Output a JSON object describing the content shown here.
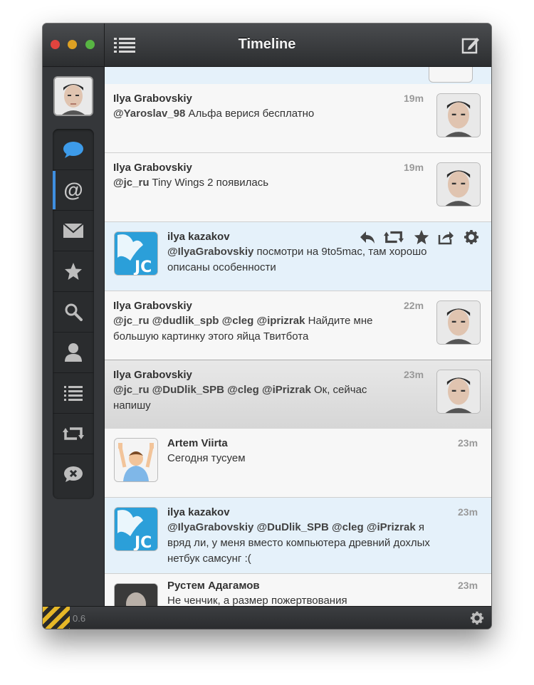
{
  "window": {
    "title": "Timeline"
  },
  "bottom": {
    "version": "0.6"
  },
  "sidebar": {
    "items": [
      {
        "name": "timeline-icon"
      },
      {
        "name": "mentions-icon"
      },
      {
        "name": "messages-icon"
      },
      {
        "name": "favorites-icon"
      },
      {
        "name": "search-icon"
      },
      {
        "name": "profile-icon"
      },
      {
        "name": "lists-icon"
      },
      {
        "name": "retweets-icon"
      },
      {
        "name": "muted-icon"
      }
    ]
  },
  "tweets": [
    {
      "name": "Ilya Grabovskiy",
      "time": "19m",
      "m1": "@Yaroslav_98",
      "t1": " Альфа верися бесплатно"
    },
    {
      "name": "Ilya Grabovskiy",
      "time": "19m",
      "m1": "@jc_ru",
      "t1": " Tiny Wings 2 появилась"
    },
    {
      "name": "ilya kazakov",
      "m1": "@IlyaGrabovskiy",
      "t1": " посмотри на 9to5mac, там хорошо",
      "line2": "описаны особенности",
      "avatar_text": "JC"
    },
    {
      "name": "Ilya Grabovskiy",
      "time": "22m",
      "m1": "@jc_ru",
      "m2": "@dudlik_spb",
      "m3": "@cleg",
      "m4": "@iprizrak",
      "t1": " Найдите мне",
      "line2": "большую картинку этого яйца Твитбота"
    },
    {
      "name": "Ilya Grabovskiy",
      "time": "23m",
      "m1": "@jc_ru",
      "m2": "@DuDlik_SPB",
      "m3": "@cleg",
      "m4": "@iPrizrak",
      "t1": " Ок, сейчас",
      "line2": "напишу"
    },
    {
      "name": "Artem Viirta",
      "time": "23m",
      "t1": "Сегодня тусуем"
    },
    {
      "name": "ilya kazakov",
      "time": "23m",
      "m1": "@IlyaGrabovskiy",
      "m2": "@DuDlik_SPB",
      "m3": "@cleg",
      "m4": "@iPrizrak",
      "t1": " я",
      "line2": "вряд ли, у меня вместо компьютера древний дохлых",
      "line3": "нетбук самсунг :(",
      "avatar_text": "JC"
    },
    {
      "name": "Рустем Адагамов",
      "time": "23m",
      "t1": "Не ченчик, а размер пожертвования"
    }
  ],
  "colors": {
    "accent": "#3f8fe0",
    "highlight_bg": "#e5f1fa",
    "stripes": "#e6b727"
  }
}
